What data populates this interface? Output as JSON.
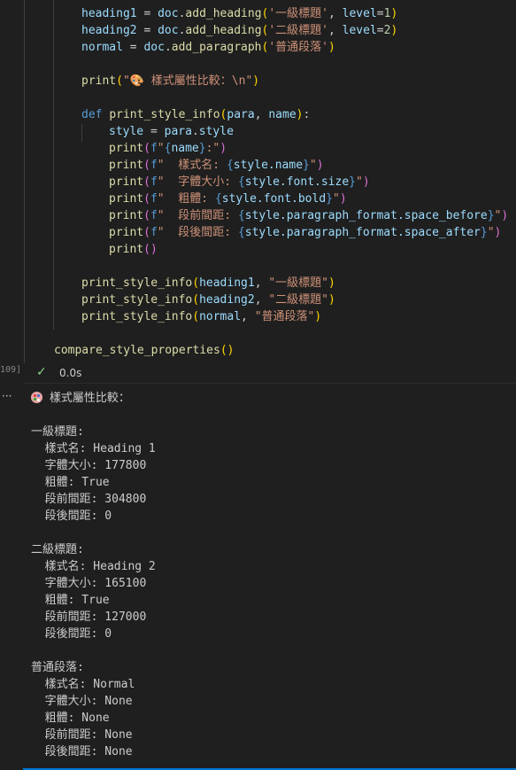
{
  "code": {
    "heading1_var": "heading1",
    "heading2_var": "heading2",
    "normal_var": "normal",
    "doc": "doc",
    "add_heading": "add_heading",
    "add_paragraph": "add_paragraph",
    "level": "level",
    "l1": "1",
    "l2": "2",
    "s_h1": "'一級標題'",
    "s_h2": "'二級標題'",
    "s_normal": "'普通段落'",
    "print": "print",
    "s_compare": "\"🎨 樣式屬性比較：\\n\"",
    "def": "def",
    "fn_name": "print_style_info",
    "para": "para",
    "name": "name",
    "style": "style",
    "style_attr": "style",
    "f": "f",
    "lines_f": [
      {
        "pre": "\"",
        "expr": "name",
        "post": ":\""
      },
      {
        "pre": "\"  樣式名: ",
        "expr": "style.name",
        "post": "\""
      },
      {
        "pre": "\"  字體大小: ",
        "expr": "style.font.size",
        "post": "\""
      },
      {
        "pre": "\"  粗體: ",
        "expr": "style.font.bold",
        "post": "\""
      },
      {
        "pre": "\"  段前間距: ",
        "expr": "style.paragraph_format.space_before",
        "post": "\""
      },
      {
        "pre": "\"  段後間距: ",
        "expr": "style.paragraph_format.space_after",
        "post": "\""
      }
    ],
    "calls": [
      {
        "arg": "heading1",
        "label": "\"一級標題\""
      },
      {
        "arg": "heading2",
        "label": "\"二級標題\""
      },
      {
        "arg": "normal",
        "label": "\"普通段落\""
      }
    ],
    "compare_call": "compare_style_properties"
  },
  "cell": {
    "exec_count": "109]",
    "status_time": "0.0s",
    "more": "···"
  },
  "output": {
    "header": "樣式屬性比較：",
    "lines": [
      "一級標題:",
      "  樣式名: Heading 1",
      "  字體大小: 177800",
      "  粗體: True",
      "  段前間距: 304800",
      "  段後間距: 0",
      "",
      "二級標題:",
      "  樣式名: Heading 2",
      "  字體大小: 165100",
      "  粗體: True",
      "  段前間距: 127000",
      "  段後間距: 0",
      "",
      "普通段落:",
      "  樣式名: Normal",
      "  字體大小: None",
      "  粗體: None",
      "  段前間距: None",
      "  段後間距: None"
    ]
  }
}
